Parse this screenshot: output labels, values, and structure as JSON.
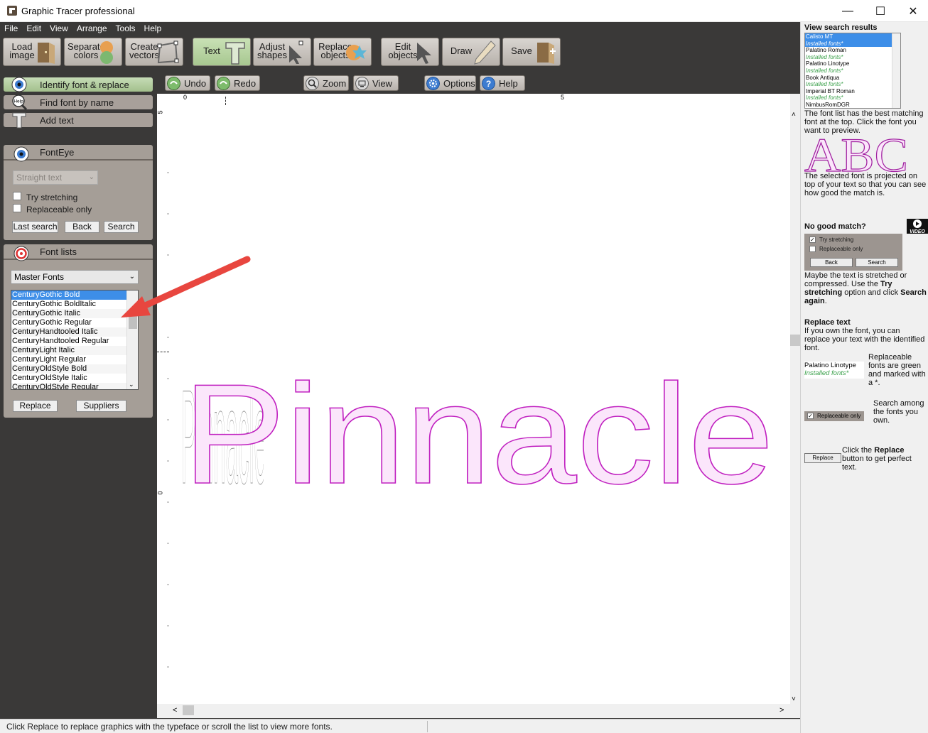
{
  "window": {
    "title": "Graphic Tracer professional",
    "minimize": "—",
    "maximize": "☐",
    "close": "✕"
  },
  "menu": [
    "File",
    "Edit",
    "View",
    "Arrange",
    "Tools",
    "Help"
  ],
  "toolbar": [
    {
      "label1": "Load",
      "label2": "image",
      "icon": "load-image-icon"
    },
    {
      "label1": "Separate",
      "label2": "colors",
      "icon": "separate-colors-icon"
    },
    {
      "label1": "Create",
      "label2": "vectors",
      "icon": "create-vectors-icon"
    },
    {
      "label1": "Text",
      "label2": "",
      "icon": "text-tool-icon",
      "active": true
    },
    {
      "label1": "Adjust",
      "label2": "shapes",
      "icon": "adjust-shapes-icon"
    },
    {
      "label1": "Replace",
      "label2": "objects",
      "icon": "replace-objects-icon"
    },
    {
      "label1": "Edit",
      "label2": "objects",
      "icon": "edit-objects-icon"
    },
    {
      "label1": "Draw",
      "label2": "",
      "icon": "draw-icon"
    },
    {
      "label1": "Save",
      "label2": "",
      "icon": "save-icon"
    }
  ],
  "secondary_toolbar": {
    "undo": "Undo",
    "redo": "Redo",
    "zoom": "Zoom",
    "view": "View",
    "options": "Options",
    "help": "Help"
  },
  "left_panel": {
    "identify": "Identify font & replace",
    "find": "Find font by name",
    "add_text": "Add text",
    "help_badge": "Help",
    "fonteye": {
      "title": "FontEye",
      "mode_select": "Straight text",
      "try_stretching": "Try stretching",
      "replaceable_only": "Replaceable only",
      "last_search": "Last search",
      "back": "Back",
      "search": "Search"
    },
    "font_lists": {
      "title": "Font lists",
      "selected_list": "Master Fonts",
      "items": [
        "CenturyGothic Bold",
        "CenturyGothic BoldItalic",
        "CenturyGothic Italic",
        "CenturyGothic Regular",
        "CenturyHandtooled Italic",
        "CenturyHandtooled Regular",
        "CenturyLight Italic",
        "CenturyLight Regular",
        "CenturyOldStyle Bold",
        "CenturyOldStyle Italic",
        "CenturyOldStyle Regular"
      ],
      "selected_index": 0,
      "replace": "Replace",
      "suppliers": "Suppliers"
    }
  },
  "canvas": {
    "text": "Pinnacle",
    "ruler_top_labels": [
      "0",
      "5"
    ],
    "ruler_left_labels": [
      "5",
      "0"
    ]
  },
  "status": "Click Replace to replace graphics with the typeface or scroll the list to view more fonts.",
  "right_panel": {
    "heading": "View search results",
    "results": [
      {
        "name": "Calisto MT",
        "installed": "Installed fonts*",
        "selected": true
      },
      {
        "name": "Palatino Roman",
        "installed": "Installed fonts*"
      },
      {
        "name": "Palatino Linotype",
        "installed": "Installed fonts*"
      },
      {
        "name": "Book Antiqua",
        "installed": "Installed fonts*"
      },
      {
        "name": "Imperial BT Roman",
        "installed": "Installed fonts*"
      },
      {
        "name": "NimbusRomDGR",
        "installed": ""
      }
    ],
    "help1": "The font list has the best matching font at the top. Click the font you want to preview.",
    "preview": "ABC",
    "help2": "The selected font is projected on top of your text so that you can see how good the match is.",
    "no_match_title": "No good match?",
    "video_label": "VIDEO",
    "mini_try_stretching": "Try stretching",
    "mini_replaceable": "Replaceable only",
    "mini_back": "Back",
    "mini_search": "Search",
    "help3_a": "Maybe the text is stretched or compressed. Use the ",
    "help3_b": "Try stretching",
    "help3_c": " option and click ",
    "help3_d": "Search again",
    "help3_e": ".",
    "replace_title": "Replace text",
    "help4": "If you own the font, you can replace your text with the identified font.",
    "sample_font": "Palatino Linotype",
    "sample_installed": "Installed fonts*",
    "help5": "Replaceable fonts are green and marked with a *.",
    "replaceable_chk": "Replaceable only",
    "help6": "Search among the fonts you own.",
    "replace_btn": "Replace",
    "help7_a": "Click the ",
    "help7_b": "Replace",
    "help7_c": " button to get perfect text."
  },
  "colors": {
    "accent": "#3d8ee8",
    "outline": "#c020c0",
    "fill": "#fbe6fb",
    "arrow": "#e8463f",
    "installed": "#3aa04a"
  }
}
